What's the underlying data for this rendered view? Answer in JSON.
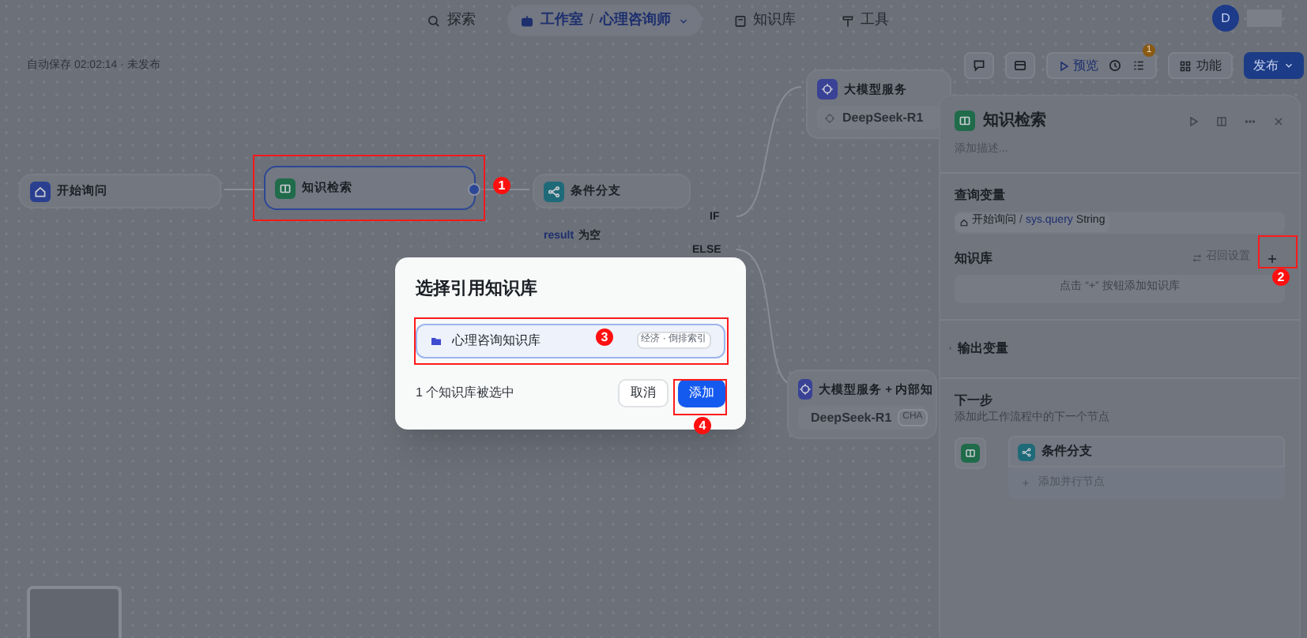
{
  "top_nav": [
    {
      "label": "探索",
      "selected": false
    },
    {
      "label": "工作室",
      "selected": true,
      "separator": "/",
      "sub": "心理咨询师"
    },
    {
      "label": "知识库",
      "selected": false
    },
    {
      "label": "工具",
      "selected": false
    }
  ],
  "avatar": "D",
  "autosave": "自动保存 02:02:14",
  "autosave_separator": "·",
  "publish_state": "未发布",
  "toolbar": {
    "preview": "预览",
    "issue_count": "1",
    "features": "功能",
    "publish": "发布"
  },
  "nodes": [
    {
      "kind": "start",
      "title": "开始询问",
      "selected": false
    },
    {
      "kind": "knowledge",
      "title": "知识检索",
      "selected": true
    },
    {
      "kind": "condition",
      "title": "条件分支",
      "selected": false,
      "var": "result",
      "op": "为空"
    },
    {
      "kind": "llm",
      "title": "大模型服务",
      "selected": false,
      "model": "DeepSeek-R1"
    },
    {
      "kind": "llm",
      "title": "大模型服务 + 内部知",
      "selected": false,
      "model": "DeepSeek-R1",
      "tag": "CHA"
    }
  ],
  "branches": [
    "IF",
    "ELSE"
  ],
  "panel": {
    "title": "知识检索",
    "description_placeholder": "添加描述...",
    "query_label": "查询变量",
    "query_node": "开始询问",
    "query_separator": "/",
    "query_var": "sys.query",
    "query_type": "String",
    "kb_label": "知识库",
    "recall": "召回设置",
    "kb_empty": "点击 “+” 按钮添加知识库",
    "output_label": "输出变量",
    "output_expanded": false,
    "next_label": "下一步",
    "next_hint": "添加此工作流程中的下一个节点",
    "next_node": "条件分支",
    "add_parallel": "添加并行节点"
  },
  "modal": {
    "title": "选择引用知识库",
    "items": [
      {
        "name": "心理咨询知识库",
        "selected": true,
        "tags": "经济 · 倒排索引"
      }
    ],
    "selection_count": "1 个知识库被选中",
    "cancel": "取消",
    "confirm": "添加"
  },
  "annotations": [
    "1",
    "2",
    "3",
    "4"
  ]
}
